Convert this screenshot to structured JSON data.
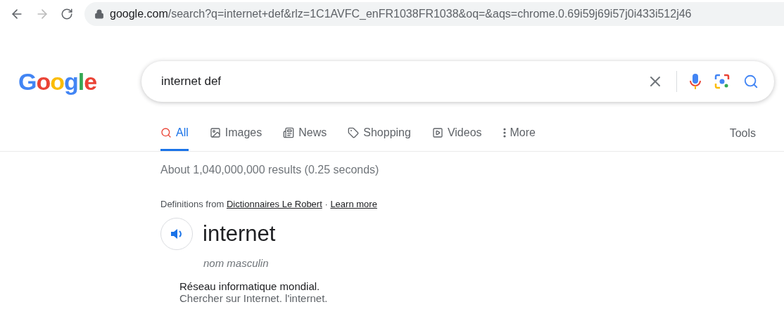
{
  "browser": {
    "url_host": "google.com",
    "url_rest": "/search?q=internet+def&rlz=1C1AVFC_enFR1038FR1038&oq=&aqs=chrome.0.69i59j69i57j0i433i512j46"
  },
  "logo": "Google",
  "search": {
    "value": "internet def"
  },
  "tabs": [
    {
      "label": "All",
      "selected": true
    },
    {
      "label": "Images",
      "selected": false
    },
    {
      "label": "News",
      "selected": false
    },
    {
      "label": "Shopping",
      "selected": false
    },
    {
      "label": "Videos",
      "selected": false
    },
    {
      "label": "More",
      "selected": false
    }
  ],
  "tools": "Tools",
  "result_stats": "About 1,040,000,000 results (0.25 seconds)",
  "definition": {
    "source_prefix": "Definitions from",
    "source_link": "Dictionnaires Le Robert",
    "separator": "·",
    "learn_more": "Learn more",
    "word": "internet",
    "part_of_speech": "nom masculin",
    "meaning": "Réseau informatique mondial.",
    "example": "Chercher sur Internet. l'internet."
  }
}
